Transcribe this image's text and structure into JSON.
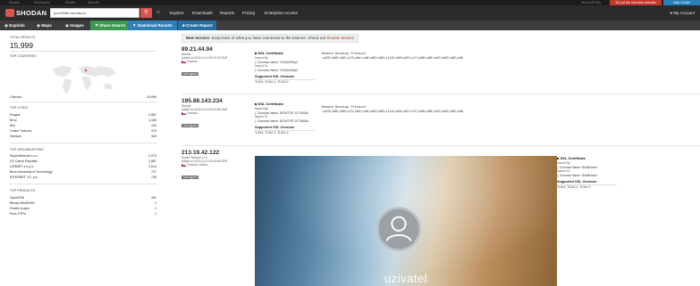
{
  "topstrip": {
    "links": [
      "Shodan",
      "Developers",
      "Monitor",
      "View All..."
    ],
    "account_link": "Show API Key",
    "promo": "Try out the new beta website!",
    "help": "Help Center"
  },
  "nav": {
    "logo": "SHODAN",
    "search_value": "port:3389 country:cz",
    "links": [
      "Explore",
      "Downloads",
      "Reports",
      "Pricing",
      "Enterprise Access"
    ],
    "account": "My Account"
  },
  "subnav": {
    "tabs": [
      "Exploits",
      "Maps",
      "Images",
      "Share Search",
      "Download Results",
      "Create Report"
    ]
  },
  "left": {
    "total_label": "TOTAL RESULTS",
    "total": "15,999",
    "countries_label": "TOP COUNTRIES",
    "countries": [
      {
        "name": "Czechia",
        "count": "15,999"
      }
    ],
    "cities_label": "TOP CITIES",
    "cities": [
      {
        "name": "Prague",
        "count": "2,857"
      },
      {
        "name": "Brno",
        "count": "1,155"
      },
      {
        "name": "Kilo",
        "count": "410"
      },
      {
        "name": "Ceske Trebova",
        "count": "374"
      },
      {
        "name": "Ostrava",
        "count": "339"
      }
    ],
    "orgs_label": "TOP ORGANIZATIONS",
    "orgs": [
      {
        "name": "SuperNetwork s.r.o.",
        "count": "2,073"
      },
      {
        "name": "O2 Czech Republic",
        "count": "1,887"
      },
      {
        "name": "CESNET z.s.p.o.",
        "count": "1,014"
      },
      {
        "name": "Brno University of Technology",
        "count": "727"
      },
      {
        "name": "INTERNET CZ, a.s.",
        "count": "735"
      }
    ],
    "products_label": "TOP PRODUCTS",
    "products": [
      {
        "name": "OpenSSH",
        "count": "181"
      },
      {
        "name": "Bitvise WinSSHD",
        "count": "1"
      },
      {
        "name": "Postfix smtpd",
        "count": "1"
      },
      {
        "name": "Pure-FTPd",
        "count": "1"
      }
    ]
  },
  "banner": {
    "pre": "New Service:",
    "text": "Keep track of what you have connected to the Internet. Check out",
    "link": "Shodan Monitor"
  },
  "results": [
    {
      "ip": "89.21.44.94",
      "org": "Starnet",
      "added": "Added on 2020-11-10 20:47:33 GMT",
      "country": "Czechia",
      "tag": "self-signed",
      "ssl": {
        "title": "SSL Certificate",
        "issued_by": "Issued By:",
        "cn_label": "|- Common Name:",
        "issuer_cn": "YOGA3000p1",
        "issued_to": "Issued To:",
        "subject_cn": "YOGA3000p1",
        "versions_title": "Supported SSL Versions",
        "versions": "TLSv1, TLSv1.1, TLSv1.2"
      },
      "proto": "Remote Desktop Protocol\n\\x03\\x00\\x00\\x13\\x0e\\xd0\\x00\\x00\\x124\\x00\\x02\\x1f\\x08\\x00\\x02\\x00\\x00\\x00"
    },
    {
      "ip": "195.88.143.234",
      "org": "Starnet",
      "added": "Added on 2020-11-10 20:44:35 GMT",
      "country": "Czechia",
      "tag": "self-signed",
      "ssl": {
        "title": "SSL Certificate",
        "issued_by": "Issued By:",
        "cn_label": "|- Common Name:",
        "issuer_cn": "DESKTOP-VCT4M4A",
        "issued_to": "Issued To:",
        "subject_cn": "DESKTOP-VCT4M4A",
        "versions_title": "Supported SSL Versions",
        "versions": "TLSv1, TLSv1.1, TLSv1.2"
      },
      "proto": "Remote Desktop Protocol\n\\x03\\x00\\x00\\x13\\x0e\\xd0\\x00\\x00\\x124\\x00\\x02\\x1f\\x08\\x00\\x02\\x00\\x00\\x00"
    },
    {
      "ip": "213.19.42.122",
      "org": "Nordic Telecom s.r.o.",
      "added": "Added on 2020-11-10 20:42:08 GMT",
      "country": "Czechia",
      "city": "Liberec",
      "tag": "self-signed",
      "ssl": {
        "title": "SSL Certificate",
        "issued_by": "Issued By:",
        "cn_label": "|- Common Name:",
        "issuer_cn": "DetailHome",
        "issued_to": "Issued To:",
        "subject_cn": "DetailHome",
        "versions_title": "Supported SSL Versions",
        "versions": "TLSv1, TLSv1.1, TLSv1.2"
      },
      "screenshot_user": "uzivatel"
    }
  ],
  "colors": {
    "brand_red": "#d9534f",
    "share_green": "#3c9a4e",
    "download_blue": "#2f7fb8",
    "dark_nav": "#2b2b2b"
  }
}
